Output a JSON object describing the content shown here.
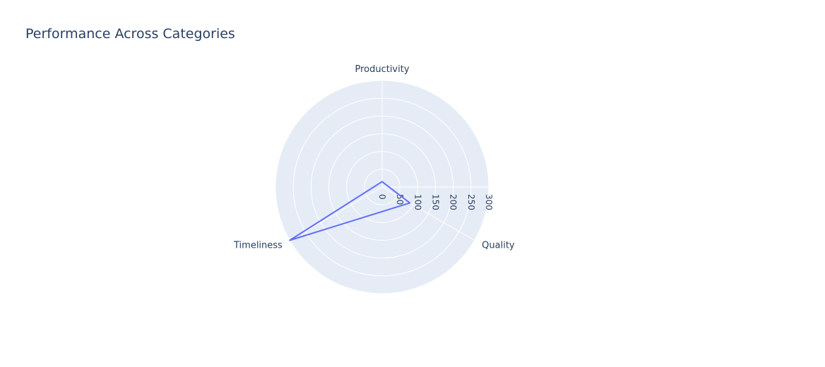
{
  "chart_data": {
    "type": "radar",
    "title": "Performance Across Categories",
    "categories": [
      "Productivity",
      "Quality",
      "Timeliness"
    ],
    "series": [
      {
        "values": [
          15,
          90,
          300
        ],
        "color": "#636efa"
      }
    ],
    "radial_range": [
      0,
      300
    ],
    "radial_ticks": [
      0,
      50,
      100,
      150,
      200,
      250,
      300
    ],
    "grid": true,
    "colors": {
      "polar_bg": "#e5ecf6",
      "grid": "#ffffff",
      "text": "#2a3f5f"
    }
  }
}
